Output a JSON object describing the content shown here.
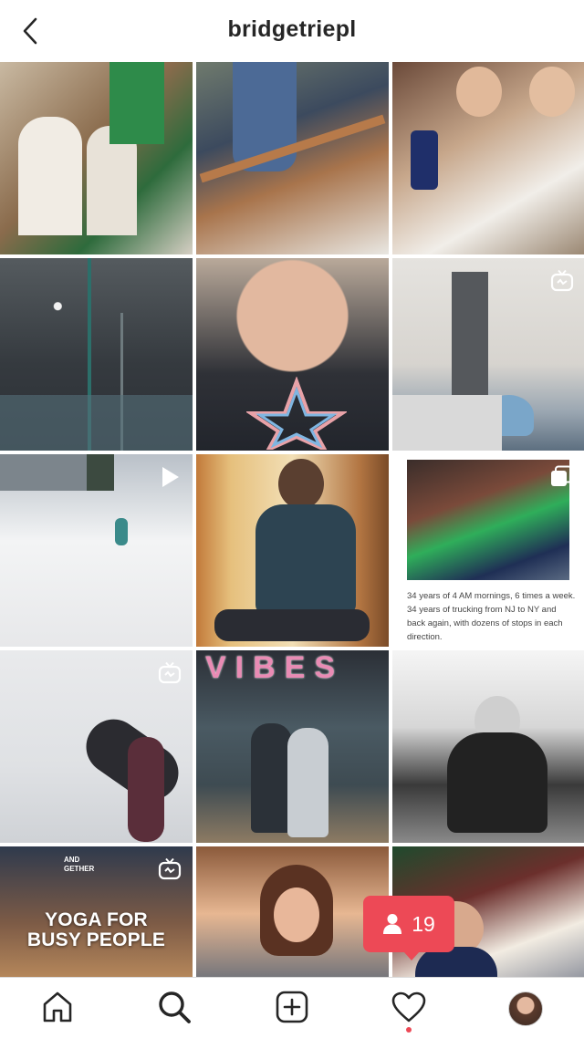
{
  "header": {
    "username": "bridgetriepl",
    "back_icon": "chevron-left-icon"
  },
  "grid": {
    "tiles": [
      {
        "kind": "photo"
      },
      {
        "kind": "photo"
      },
      {
        "kind": "photo"
      },
      {
        "kind": "photo"
      },
      {
        "kind": "photo"
      },
      {
        "kind": "igtv",
        "badge_icon": "igtv-icon"
      },
      {
        "kind": "video",
        "badge_icon": "play-icon"
      },
      {
        "kind": "photo"
      },
      {
        "kind": "carousel",
        "badge_icon": "carousel-icon",
        "caption": "34 years of 4 AM mornings, 6 times a week. 34 years of trucking from NJ to NY and back again, with dozens of stops in each direction."
      },
      {
        "kind": "igtv",
        "badge_icon": "igtv-icon"
      },
      {
        "kind": "photo",
        "sign_text": "VIBES"
      },
      {
        "kind": "photo"
      },
      {
        "kind": "igtv",
        "badge_icon": "igtv-icon",
        "overlay_line1": "YOGA FOR",
        "overlay_line2": "BUSY PEOPLE",
        "shirt_text": "AND GETHER"
      },
      {
        "kind": "photo"
      },
      {
        "kind": "photo"
      }
    ]
  },
  "activity_popup": {
    "icon": "person-icon",
    "count": "19"
  },
  "bottom_nav": {
    "items": [
      "home-icon",
      "search-icon",
      "new-post-icon",
      "heart-icon",
      "profile-avatar"
    ]
  },
  "colors": {
    "accent_red": "#ed4956",
    "text": "#262626",
    "divider": "#dbdbdb"
  }
}
